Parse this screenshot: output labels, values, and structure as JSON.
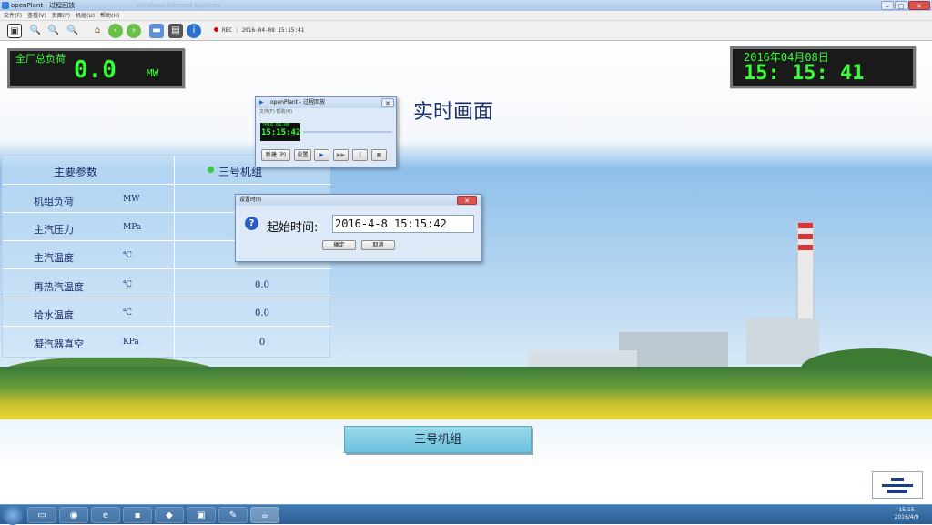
{
  "window": {
    "title": "openPlant - 过程回放",
    "ghost_title": "Windows Internet Explorer"
  },
  "menu": [
    "文件(F)",
    "查看(V)",
    "页面(P)",
    "机组(U)",
    "帮助(H)"
  ],
  "toolbar": {
    "rec_label": "REC",
    "rec_time": "2016-04-08 15:15:41",
    "icons": [
      "fullscreen-icon",
      "zoom-in-icon",
      "zoom-out-icon",
      "zoom-fit-icon",
      "home-icon",
      "back-icon",
      "forward-icon",
      "folder-icon",
      "print-icon",
      "info-icon"
    ]
  },
  "load_panel": {
    "label": "全厂总负荷",
    "value": "0.0",
    "unit": "MW"
  },
  "datetime_panel": {
    "date": "2016年04月08日",
    "time": "15: 15: 41"
  },
  "page_title_text": "实时画面",
  "table": {
    "header": {
      "param": "主要参数",
      "unit_name": "三号机组",
      "status_color": "#33cc33"
    },
    "rows": [
      {
        "name": "机组负荷",
        "unit": "MW",
        "value": ""
      },
      {
        "name": "主汽压力",
        "unit": "MPa",
        "value": ""
      },
      {
        "name": "主汽温度",
        "unit": "℃",
        "value": ""
      },
      {
        "name": "再热汽温度",
        "unit": "℃",
        "value": "0.0"
      },
      {
        "name": "给水温度",
        "unit": "℃",
        "value": "0.0"
      },
      {
        "name": "凝汽器真空",
        "unit": "KPa",
        "value": "0"
      }
    ]
  },
  "bottom_button": "三号机组",
  "playback_dialog": {
    "title": "openPlant - 过程回放",
    "menu": "文件(F)  帮助(H)",
    "date": "2016-04-08",
    "time": "15:15:42",
    "new_btn": "新建 (P)",
    "set_btn": "设置"
  },
  "settime_dialog": {
    "title": "设置时间",
    "label": "起始时间:",
    "value": "2016-4-8  15:15:42",
    "ok": "确定",
    "cancel": "取消"
  },
  "taskbar": {
    "time": "15:15",
    "date": "2016/4/9"
  }
}
